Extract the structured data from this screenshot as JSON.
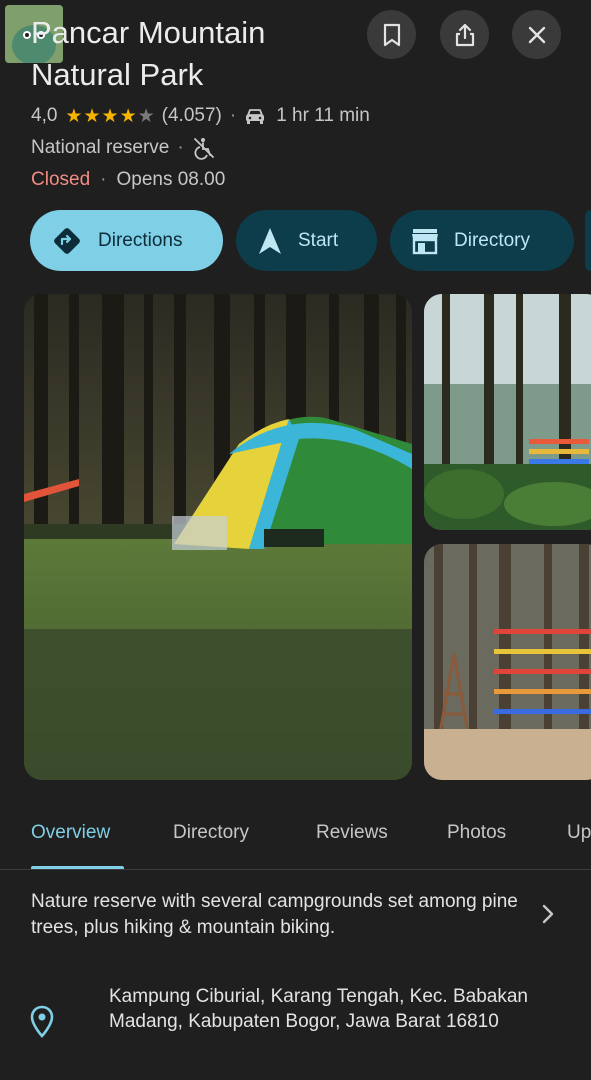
{
  "place": {
    "name": "Pancar Mountain Natural Park",
    "rating": "4,0",
    "reviews_count": "(4.057)",
    "drive_time": "1 hr 11 min",
    "type": "National reserve",
    "status": "Closed",
    "opens": "Opens 08.00",
    "stars": 4
  },
  "actions": {
    "directions": "Directions",
    "start": "Start",
    "directory": "Directory"
  },
  "tabs": {
    "overview": "Overview",
    "directory": "Directory",
    "reviews": "Reviews",
    "photos": "Photos",
    "updates": "Up"
  },
  "overview": {
    "description": "Nature reserve with several campgrounds set among pine trees, plus hiking & mountain biking.",
    "address": "Kampung Ciburial, Karang Tengah, Kec. Babakan Madang, Kabupaten Bogor, Jawa Barat 16810"
  },
  "colors": {
    "accent": "#7fcfe6",
    "closed": "#f28b82",
    "star": "#f5b400",
    "background": "#1f1f1f"
  }
}
